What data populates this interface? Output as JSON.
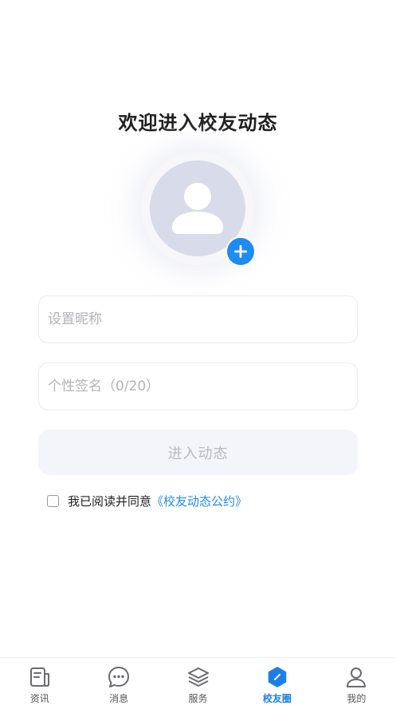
{
  "page": {
    "title": "欢迎进入校友动态"
  },
  "form": {
    "nickname_placeholder": "设置昵称",
    "signature_placeholder": "个性签名（0/20）",
    "submit_label": "进入动态"
  },
  "agreement": {
    "text": "我已阅读并同意",
    "link": "《校友动态公约》",
    "checked": false
  },
  "tabbar": {
    "items": [
      {
        "label": "资讯",
        "icon": "news-icon",
        "active": false
      },
      {
        "label": "消息",
        "icon": "message-icon",
        "active": false
      },
      {
        "label": "服务",
        "icon": "layers-icon",
        "active": false
      },
      {
        "label": "校友圈",
        "icon": "alumni-circle-icon",
        "active": true
      },
      {
        "label": "我的",
        "icon": "user-icon",
        "active": false
      }
    ]
  },
  "colors": {
    "accent": "#1d8bf0",
    "avatar_bg": "#d8dbe9",
    "button_bg": "#f4f5fa"
  }
}
